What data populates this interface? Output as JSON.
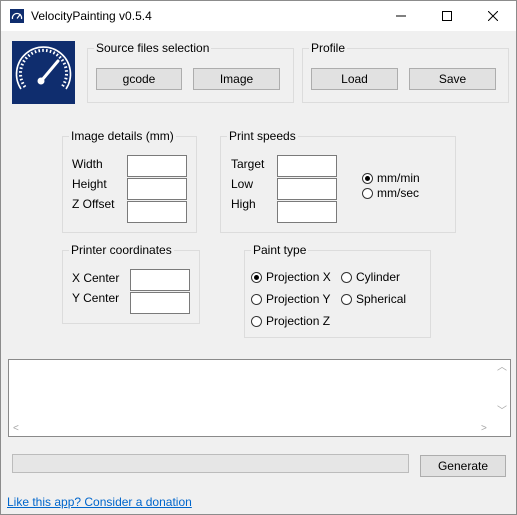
{
  "window": {
    "title": "VelocityPainting v0.5.4",
    "icons": {
      "app": "speedometer-icon",
      "minimize": "minimize-icon",
      "maximize": "maximize-icon",
      "close": "close-icon"
    }
  },
  "logo": {
    "icon": "speedometer-logo"
  },
  "source": {
    "legend": "Source files selection",
    "gcode_label": "gcode",
    "image_label": "Image"
  },
  "profile": {
    "legend": "Profile",
    "load_label": "Load",
    "save_label": "Save"
  },
  "image_details": {
    "legend": "Image details (mm)",
    "width_label": "Width",
    "height_label": "Height",
    "zoffset_label": "Z Offset",
    "width_value": "",
    "height_value": "",
    "zoffset_value": ""
  },
  "print_speeds": {
    "legend": "Print speeds",
    "target_label": "Target",
    "low_label": "Low",
    "high_label": "High",
    "target_value": "",
    "low_value": "",
    "high_value": "",
    "units": [
      "mm/min",
      "mm/sec"
    ],
    "selected_unit": "mm/min"
  },
  "printer_coords": {
    "legend": "Printer coordinates",
    "xcenter_label": "X Center",
    "ycenter_label": "Y Center",
    "xcenter_value": "",
    "ycenter_value": ""
  },
  "paint_type": {
    "legend": "Paint type",
    "options": [
      "Projection X",
      "Projection Y",
      "Projection Z",
      "Cylinder",
      "Spherical"
    ],
    "selected": "Projection X"
  },
  "log": {
    "text": ""
  },
  "progress": {
    "value": 0
  },
  "generate_label": "Generate",
  "donate_link": "Like this app? Consider a donation",
  "colors": {
    "logo_bg": "#0f2d6e",
    "link": "#0066cc",
    "window_bg": "#f0f0f0"
  }
}
